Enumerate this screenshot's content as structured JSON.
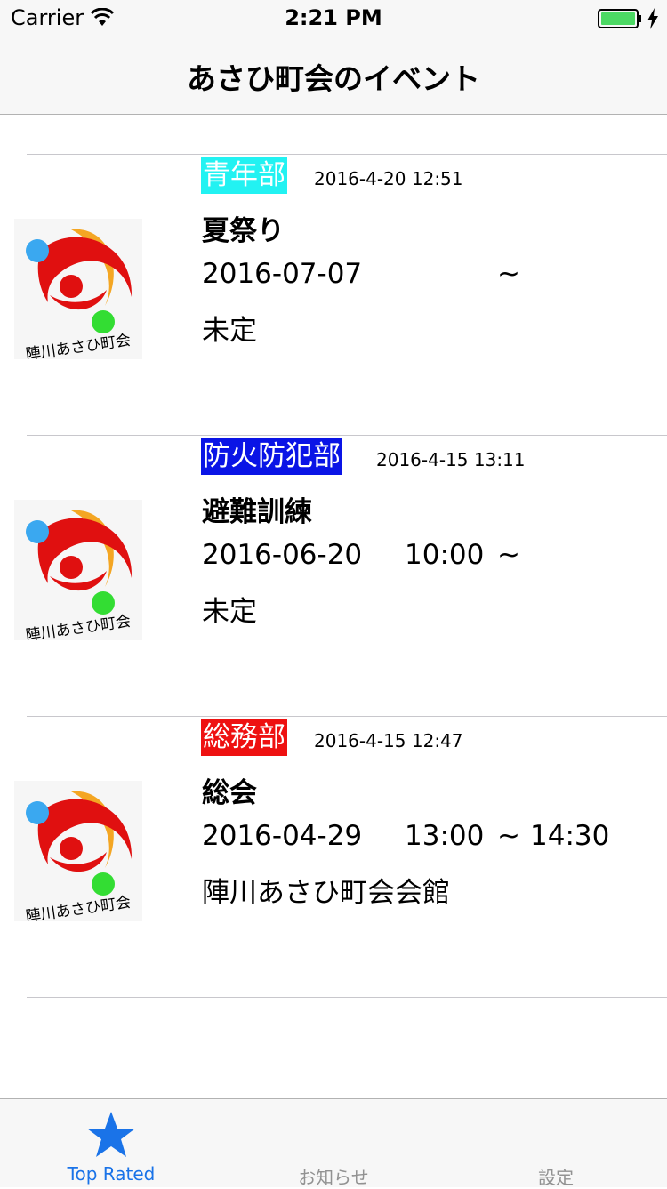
{
  "status": {
    "carrier": "Carrier",
    "time": "2:21 PM"
  },
  "nav": {
    "title": "あさひ町会のイベント"
  },
  "events": [
    {
      "tag": "青年部",
      "tag_color": "#22f2f2",
      "posted": "2016-4-20 12:51",
      "title": "夏祭り",
      "date": "2016-07-07",
      "start": "",
      "tilde": "~",
      "end": "",
      "place": "未定",
      "logo_text": "陣川あさひ町会"
    },
    {
      "tag": "防火防犯部",
      "tag_color": "#0a14e6",
      "posted": "2016-4-15 13:11",
      "title": "避難訓練",
      "date": "2016-06-20",
      "start": "10:00",
      "tilde": "~",
      "end": "",
      "place": "未定",
      "logo_text": "陣川あさひ町会"
    },
    {
      "tag": "総務部",
      "tag_color": "#ee1111",
      "posted": "2016-4-15 12:47",
      "title": "総会",
      "date": "2016-04-29",
      "start": "13:00",
      "tilde": "~",
      "end": "14:30",
      "place": "陣川あさひ町会会館",
      "logo_text": "陣川あさひ町会"
    }
  ],
  "tabs": [
    {
      "label": "Top Rated",
      "icon": "star-icon",
      "active": true
    },
    {
      "label": "お知らせ",
      "active": false
    },
    {
      "label": "設定",
      "active": false
    }
  ],
  "colors": {
    "accent": "#1a73e8",
    "logo_red": "#e01010",
    "logo_orange": "#f4a623",
    "logo_blue": "#3aa8f0",
    "logo_green": "#33dd33"
  }
}
